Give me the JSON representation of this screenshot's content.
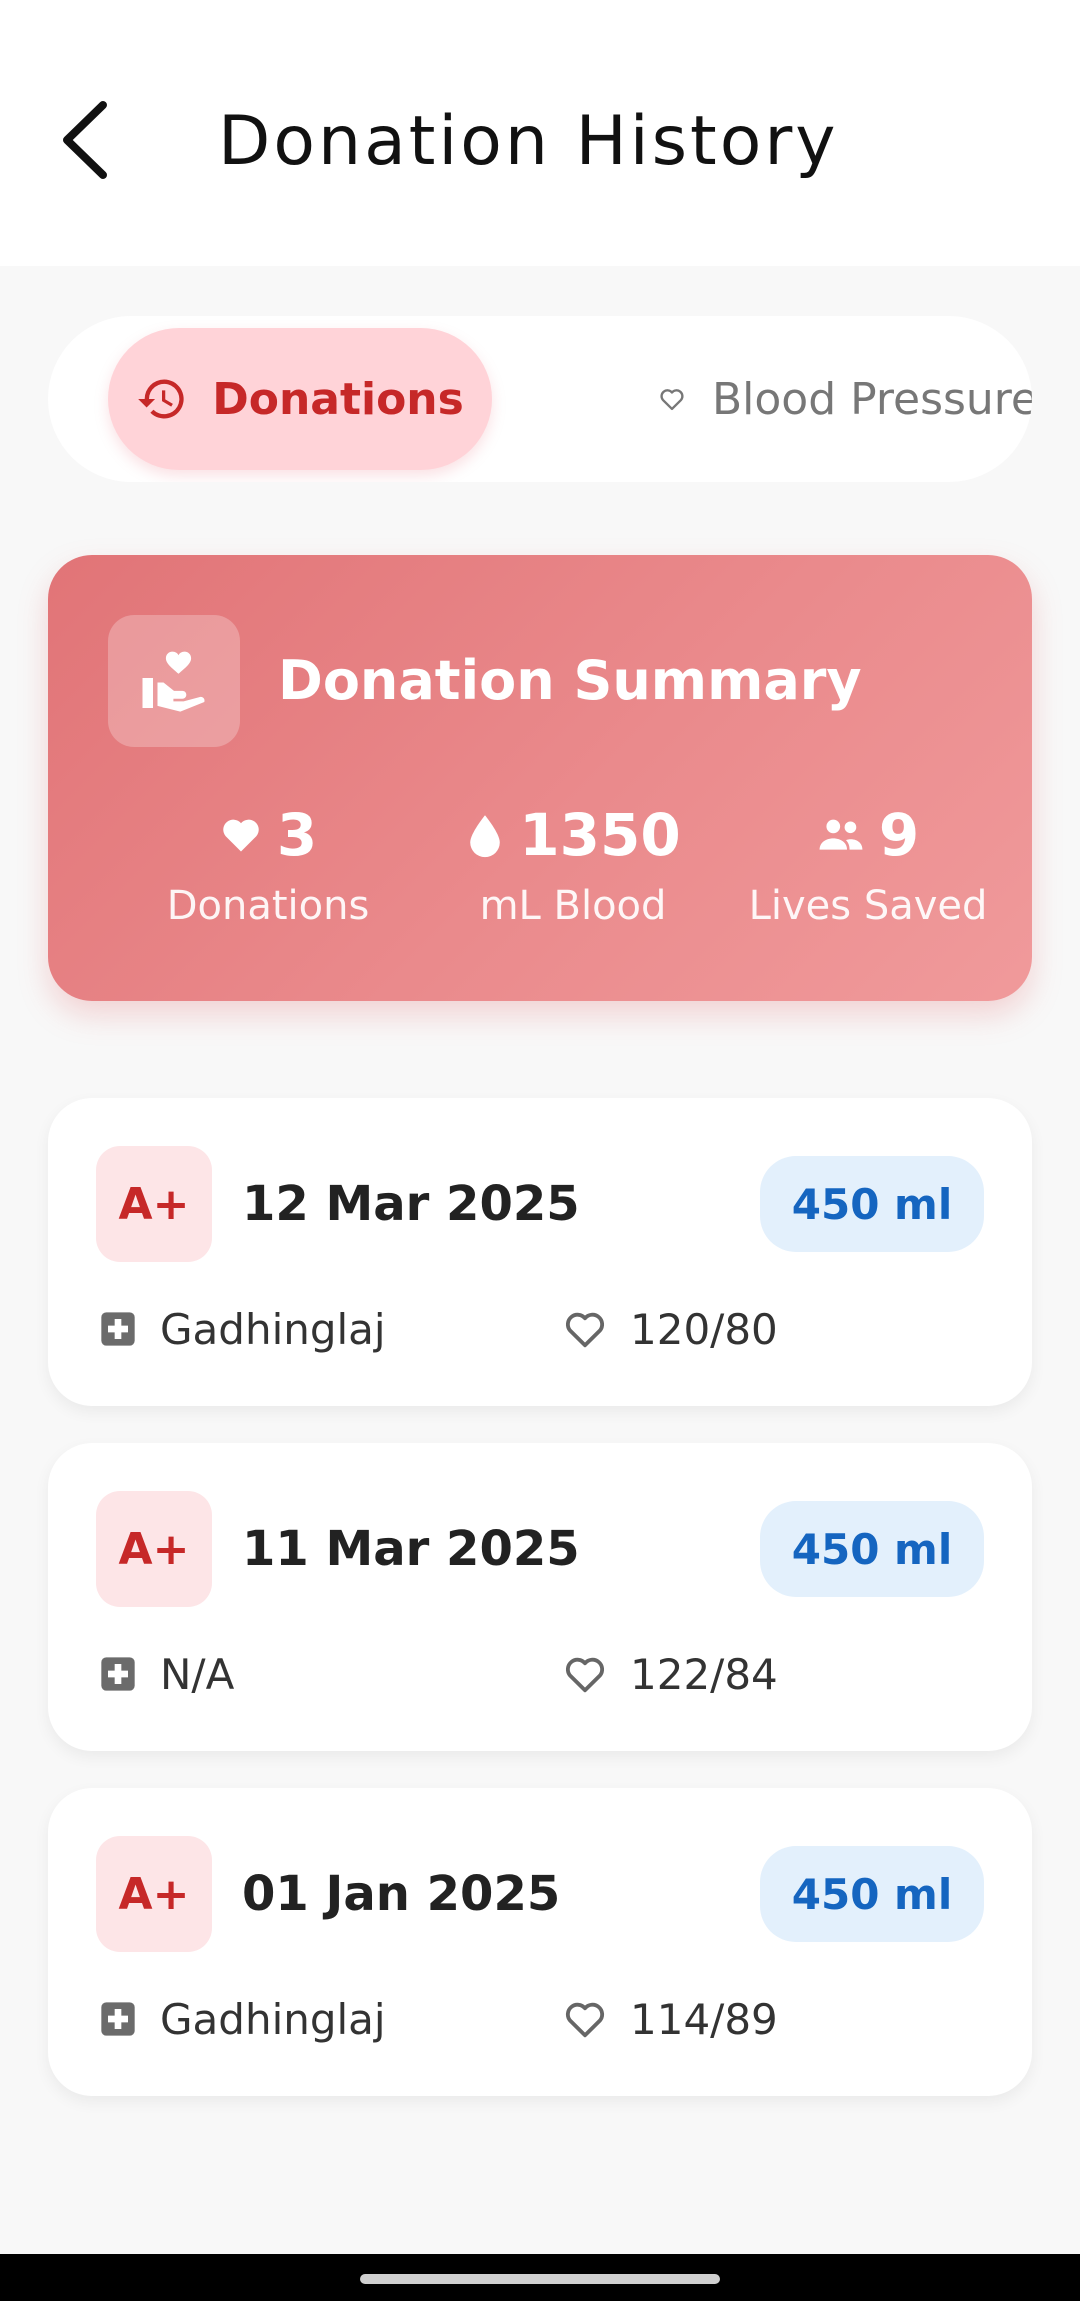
{
  "header": {
    "title": "Donation History"
  },
  "tabs": [
    {
      "label": "Donations",
      "icon": "history-icon",
      "active": true
    },
    {
      "label": "Blood Pressure",
      "icon": "heart-outline-icon",
      "active": false
    }
  ],
  "summary": {
    "title": "Donation Summary",
    "icon": "hand-heart-icon",
    "stats": [
      {
        "value": "3",
        "label": "Donations",
        "icon": "heart-icon"
      },
      {
        "value": "1350",
        "label": "mL Blood",
        "icon": "drop-icon"
      },
      {
        "value": "9",
        "label": "Lives Saved",
        "icon": "people-icon"
      }
    ]
  },
  "donations": [
    {
      "blood_group": "A+",
      "date": "12 Mar 2025",
      "volume": "450 ml",
      "location": "Gadhinglaj",
      "bp": "120/80"
    },
    {
      "blood_group": "A+",
      "date": "11 Mar 2025",
      "volume": "450 ml",
      "location": "N/A",
      "bp": "122/84"
    },
    {
      "blood_group": "A+",
      "date": "01 Jan 2025",
      "volume": "450 ml",
      "location": "Gadhinglaj",
      "bp": "114/89"
    }
  ],
  "colors": {
    "accent": "#c62828",
    "summary_gradient_start": "#e17477",
    "summary_gradient_end": "#f09a9b",
    "volume_badge_bg": "#e3f0fc",
    "volume_badge_text": "#1565c0"
  }
}
